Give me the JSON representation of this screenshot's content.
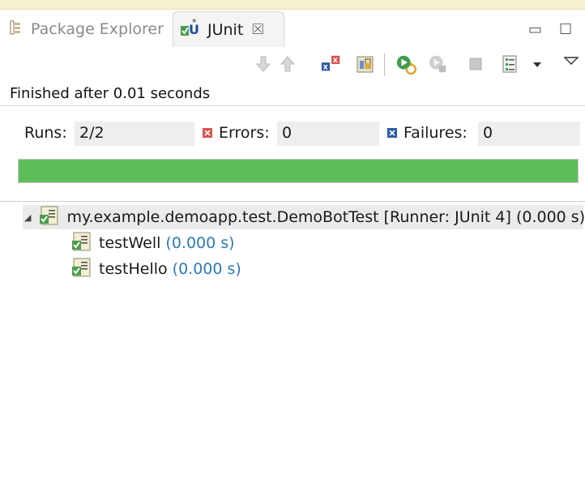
{
  "tabs": [
    {
      "label": "Package Explorer",
      "active": false,
      "icon": "package-explorer-icon"
    },
    {
      "label": "JUnit",
      "active": true,
      "icon": "junit-icon"
    }
  ],
  "close_glyph": "☒",
  "window_controls": {
    "minimize": "▭",
    "maximize": "☐"
  },
  "toolbar": {
    "icons": [
      "next-failure-icon",
      "previous-failure-icon",
      "show-failures-only-icon",
      "scroll-lock-icon",
      "rerun-test-icon",
      "rerun-failed-first-icon",
      "stop-icon",
      "test-run-history-icon",
      "history-dropdown-icon",
      "view-menu-icon"
    ]
  },
  "status": "Finished after 0.01 seconds",
  "counters": {
    "runs_label": "Runs:",
    "runs_value": "2/2",
    "errors_label": "Errors:",
    "errors_value": "0",
    "failures_label": "Failures:",
    "failures_value": "0"
  },
  "progress": {
    "fraction": 1.0,
    "color": "#5cbf5c"
  },
  "tree": {
    "root": {
      "name": "my.example.demoapp.test.DemoBotTest [Runner: JUnit 4] (0.000 s)",
      "expanded": true
    },
    "children": [
      {
        "name": "testWell",
        "time": "(0.000 s)"
      },
      {
        "name": "testHello",
        "time": "(0.000 s)"
      }
    ]
  },
  "colors": {
    "time": "#2a7bb8",
    "success": "#5cbf5c",
    "error": "#d9534f",
    "failure": "#2f5aa8"
  }
}
